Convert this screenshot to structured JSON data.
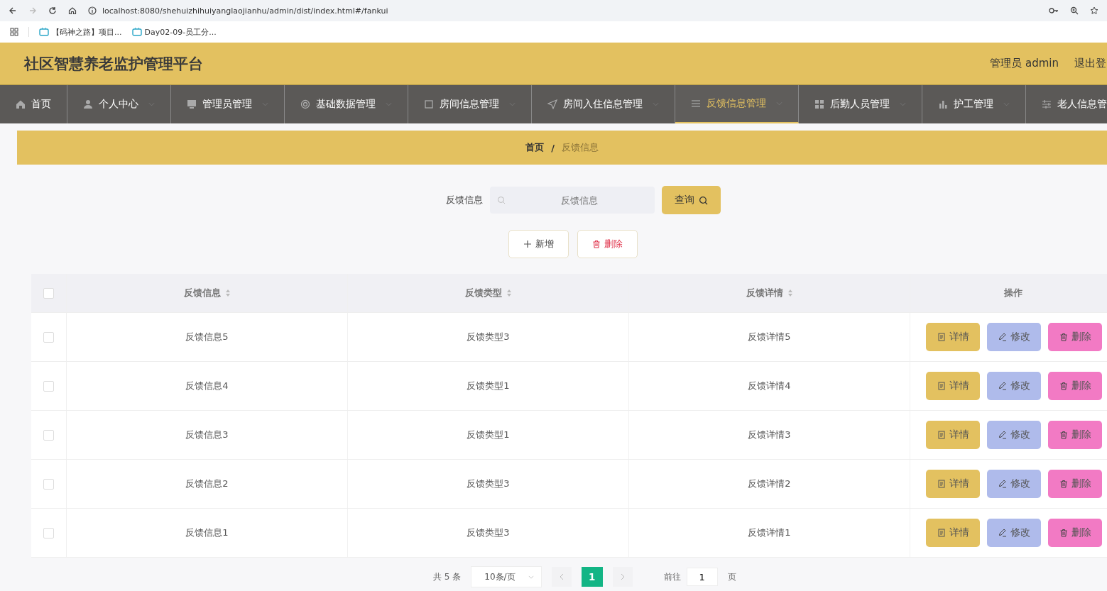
{
  "browser": {
    "url": "localhost:8080/shehuizhihuiyanglaojianhu/admin/dist/index.html#/fankui",
    "bookmarks": [
      "【码神之路】项目...",
      "Day02-09-员工分..."
    ]
  },
  "header": {
    "title": "社区智慧养老监护管理平台",
    "user": "管理员 admin",
    "logout": "退出登"
  },
  "nav": [
    {
      "label": "首页",
      "selected": false,
      "dropdown": false
    },
    {
      "label": "个人中心",
      "selected": false,
      "dropdown": true
    },
    {
      "label": "管理员管理",
      "selected": false,
      "dropdown": true
    },
    {
      "label": "基础数据管理",
      "selected": false,
      "dropdown": true
    },
    {
      "label": "房间信息管理",
      "selected": false,
      "dropdown": true
    },
    {
      "label": "房间入住信息管理",
      "selected": false,
      "dropdown": true
    },
    {
      "label": "反馈信息管理",
      "selected": true,
      "dropdown": true
    },
    {
      "label": "后勤人员管理",
      "selected": false,
      "dropdown": true
    },
    {
      "label": "护工管理",
      "selected": false,
      "dropdown": true
    },
    {
      "label": "老人信息管",
      "selected": false,
      "dropdown": false
    }
  ],
  "breadcrumb": {
    "items": [
      "首页",
      "反馈信息"
    ],
    "separator": "/"
  },
  "search": {
    "label": "反馈信息",
    "placeholder": "反馈信息",
    "button": "查询"
  },
  "actions": {
    "add": "新增",
    "delete": "删除"
  },
  "table": {
    "select_all_checked": false,
    "columns": [
      "反馈信息",
      "反馈类型",
      "反馈详情",
      "操作"
    ],
    "rows": [
      {
        "cells": [
          "反馈信息5",
          "反馈类型3",
          "反馈详情5"
        ],
        "checked": false,
        "buttons": [
          "详情",
          "修改",
          "删除"
        ]
      },
      {
        "cells": [
          "反馈信息4",
          "反馈类型1",
          "反馈详情4"
        ],
        "checked": false,
        "buttons": [
          "详情",
          "修改",
          "删除"
        ]
      },
      {
        "cells": [
          "反馈信息3",
          "反馈类型1",
          "反馈详情3"
        ],
        "checked": false,
        "buttons": [
          "详情",
          "修改",
          "删除"
        ]
      },
      {
        "cells": [
          "反馈信息2",
          "反馈类型3",
          "反馈详情2"
        ],
        "checked": false,
        "buttons": [
          "详情",
          "修改",
          "删除"
        ]
      },
      {
        "cells": [
          "反馈信息1",
          "反馈类型3",
          "反馈详情1"
        ],
        "checked": false,
        "buttons": [
          "详情",
          "修改",
          "删除"
        ]
      }
    ]
  },
  "pagination": {
    "total": "共 5 条",
    "page_size": "10条/页",
    "pages": [
      {
        "label": "1",
        "selected": true
      }
    ],
    "goto": "前往",
    "goto_value": "1",
    "page_unit": "页"
  }
}
